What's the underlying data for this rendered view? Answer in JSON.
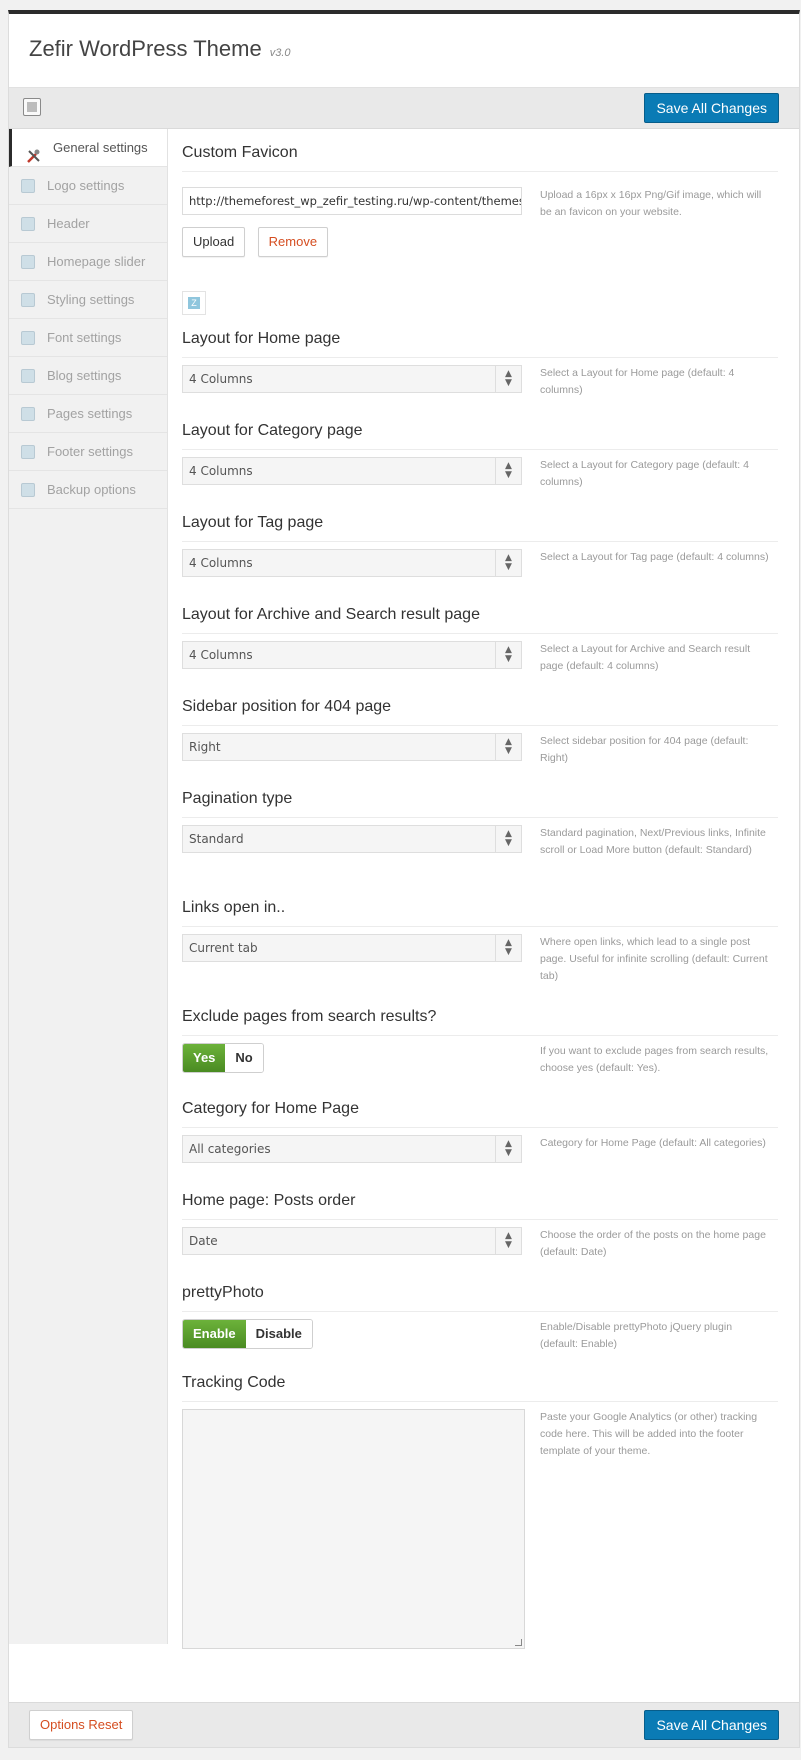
{
  "header": {
    "title": "Zefir WordPress Theme",
    "version": "v3.0"
  },
  "toolbar": {
    "save_label": "Save All Changes"
  },
  "sidebar": {
    "items": [
      {
        "label": "General settings",
        "icon": "tools-icon"
      },
      {
        "label": "Logo settings",
        "icon": "image-icon"
      },
      {
        "label": "Header",
        "icon": "header-icon"
      },
      {
        "label": "Homepage slider",
        "icon": "slider-icon"
      },
      {
        "label": "Styling settings",
        "icon": "paint-bucket-icon"
      },
      {
        "label": "Font settings",
        "icon": "font-icon"
      },
      {
        "label": "Blog settings",
        "icon": "blog-icon"
      },
      {
        "label": "Pages settings",
        "icon": "page-icon"
      },
      {
        "label": "Footer settings",
        "icon": "footer-icon"
      },
      {
        "label": "Backup options",
        "icon": "backup-icon"
      }
    ]
  },
  "favicon": {
    "title": "Custom Favicon",
    "url": "http://themeforest_wp_zefir_testing.ru/wp-content/themes/zefir/images/favicon.png",
    "upload_label": "Upload",
    "remove_label": "Remove",
    "preview_letter": "Z",
    "desc": "Upload a 16px x 16px Png/Gif image, which will be an favicon on your website."
  },
  "layout_home": {
    "title": "Layout for Home page",
    "value": "4 Columns",
    "desc": "Select a Layout for Home page (default: 4 columns)"
  },
  "layout_category": {
    "title": "Layout for Category page",
    "value": "4 Columns",
    "desc": "Select a Layout for Category page (default: 4 columns)"
  },
  "layout_tag": {
    "title": "Layout for Tag page",
    "value": "4 Columns",
    "desc": "Select a Layout for Tag page (default: 4 columns)"
  },
  "layout_archive": {
    "title": "Layout for Archive and Search result page",
    "value": "4 Columns",
    "desc": "Select a Layout for Archive and Search result page (default: 4 columns)"
  },
  "sidebar_404": {
    "title": "Sidebar position for 404 page",
    "value": "Right",
    "desc": "Select sidebar position for 404 page (default: Right)"
  },
  "pagination": {
    "title": "Pagination type",
    "value": "Standard",
    "desc": "Standard pagination, Next/Previous links, Infinite scroll or Load More button (default: Standard)"
  },
  "links_open": {
    "title": "Links open in..",
    "value": "Current tab",
    "desc": "Where open links, which lead to a single post page. Useful for infinite scrolling (default: Current tab)"
  },
  "exclude_pages": {
    "title": "Exclude pages from search results?",
    "on_label": "Yes",
    "off_label": "No",
    "desc": "If you want to exclude pages from search results, choose yes (default: Yes)."
  },
  "home_category": {
    "title": "Category for Home Page",
    "value": "All categories",
    "desc": "Category for Home Page (default: All categories)"
  },
  "posts_order": {
    "title": "Home page: Posts order",
    "value": "Date",
    "desc": "Choose the order of the posts on the home page (default: Date)"
  },
  "pretty_photo": {
    "title": "prettyPhoto",
    "on_label": "Enable",
    "off_label": "Disable",
    "desc": "Enable/Disable prettyPhoto jQuery plugin (default: Enable)"
  },
  "tracking": {
    "title": "Tracking Code",
    "value": "",
    "desc": "Paste your Google Analytics (or other) tracking code here. This will be added into the footer template of your theme."
  },
  "footer": {
    "reset_label": "Options Reset",
    "save_label": "Save All Changes"
  },
  "colors": {
    "primary_button": "#0a7bb5",
    "toggle_on": "#5aa02c",
    "remove_text": "#d54e21",
    "top_border": "#2b2b2b"
  }
}
